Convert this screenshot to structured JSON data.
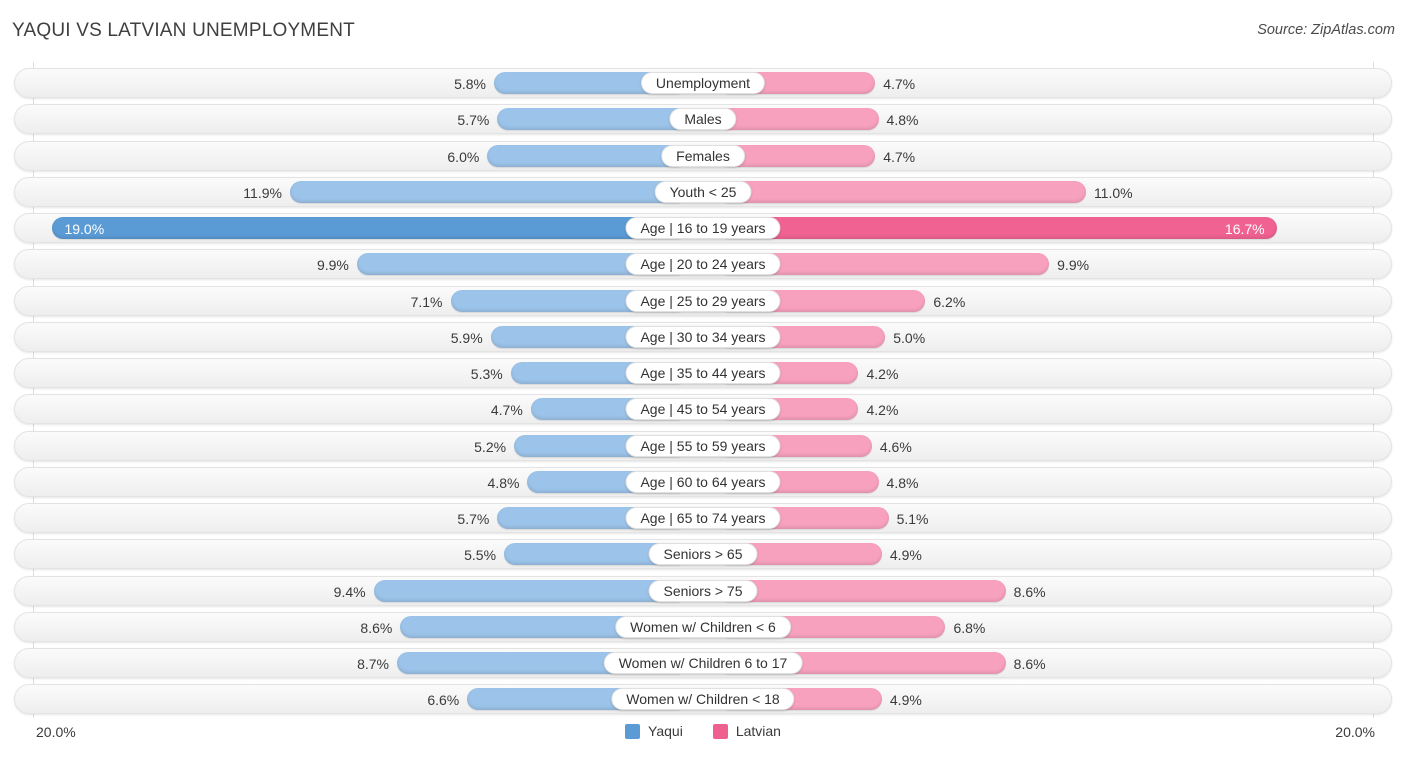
{
  "header": {
    "title": "YAQUI VS LATVIAN UNEMPLOYMENT",
    "source": "Source: ZipAtlas.com"
  },
  "footer": {
    "axis_left": "20.0%",
    "axis_right": "20.0%",
    "legend": [
      {
        "label": "Yaqui",
        "color": "#5b9bd5"
      },
      {
        "label": "Latvian",
        "color": "#f0608f"
      }
    ]
  },
  "colors": {
    "left_bar": "#9cc3e9",
    "left_bar_max": "#5b9bd5",
    "right_bar": "#f7a1bf",
    "right_bar_max": "#f06292",
    "track": "#f4f4f4",
    "gridline": "#dedede"
  },
  "chart_data": {
    "type": "bar",
    "title": "YAQUI VS LATVIAN UNEMPLOYMENT",
    "subtitle": "Source: ZipAtlas.com",
    "orientation": "horizontal-diverging",
    "xlabel": "",
    "ylabel": "",
    "axis_max": 20.0,
    "axis_min": 0.0,
    "axis_unit": "%",
    "grid": true,
    "legend_position": "bottom-center",
    "categories": [
      "Unemployment",
      "Males",
      "Females",
      "Youth < 25",
      "Age | 16 to 19 years",
      "Age | 20 to 24 years",
      "Age | 25 to 29 years",
      "Age | 30 to 34 years",
      "Age | 35 to 44 years",
      "Age | 45 to 54 years",
      "Age | 55 to 59 years",
      "Age | 60 to 64 years",
      "Age | 65 to 74 years",
      "Seniors > 65",
      "Seniors > 75",
      "Women w/ Children < 6",
      "Women w/ Children 6 to 17",
      "Women w/ Children < 18"
    ],
    "series": [
      {
        "name": "Yaqui",
        "color": "#5b9bd5",
        "values": [
          5.8,
          5.7,
          6.0,
          11.9,
          19.0,
          9.9,
          7.1,
          5.9,
          5.3,
          4.7,
          5.2,
          4.8,
          5.7,
          5.5,
          9.4,
          8.6,
          8.7,
          6.6
        ],
        "labels": [
          "5.8%",
          "5.7%",
          "6.0%",
          "11.9%",
          "19.0%",
          "9.9%",
          "7.1%",
          "5.9%",
          "5.3%",
          "4.7%",
          "5.2%",
          "4.8%",
          "5.7%",
          "5.5%",
          "9.4%",
          "8.6%",
          "8.7%",
          "6.6%"
        ]
      },
      {
        "name": "Latvian",
        "color": "#f0608f",
        "values": [
          4.7,
          4.8,
          4.7,
          11.0,
          16.7,
          9.9,
          6.2,
          5.0,
          4.2,
          4.2,
          4.6,
          4.8,
          5.1,
          4.9,
          8.6,
          6.8,
          8.6,
          4.9
        ],
        "labels": [
          "4.7%",
          "4.8%",
          "4.7%",
          "11.0%",
          "16.7%",
          "9.9%",
          "6.2%",
          "5.0%",
          "4.2%",
          "4.2%",
          "4.6%",
          "4.8%",
          "5.1%",
          "4.9%",
          "8.6%",
          "6.8%",
          "8.6%",
          "4.9%"
        ]
      }
    ],
    "highlight_row_index": 4
  }
}
